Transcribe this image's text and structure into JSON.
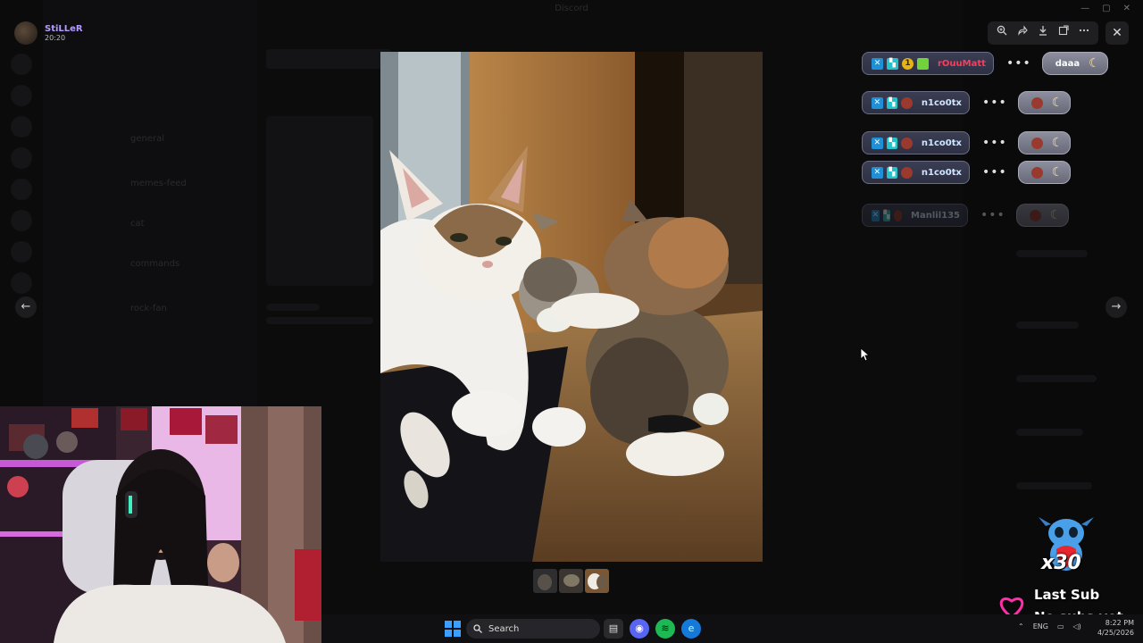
{
  "window": {
    "title": "Discord",
    "controls": [
      "—",
      "▢",
      "✕"
    ]
  },
  "user": {
    "name": "StiLLeR",
    "time": "20:20"
  },
  "background": {
    "channels": [
      "general",
      "memes-feed",
      "cat",
      "commands",
      "rock-fan"
    ]
  },
  "viewer": {
    "toolbar_icons": [
      "zoom-icon",
      "forward-icon",
      "download-icon",
      "open-external-icon",
      "more-icon"
    ],
    "close_glyph": "✕",
    "prev_glyph": "←",
    "next_glyph": "→",
    "thumbnails": 3,
    "selected_thumbnail": 3
  },
  "chat_overlay": {
    "messages": [
      {
        "user": "rOuuMatt",
        "badges": [
          "blue",
          "teal",
          "gold",
          "green"
        ],
        "badge_number": "1",
        "text": "daaa",
        "name_color": "#ff3b5c"
      },
      {
        "user": "n1co0tx",
        "badges": [
          "blue",
          "teal",
          "pot"
        ],
        "text": "",
        "name_color": "#cfe6ff"
      },
      {
        "user": "n1co0tx",
        "badges": [
          "blue",
          "teal",
          "pot"
        ],
        "text": "",
        "name_color": "#cfe6ff"
      },
      {
        "user": "n1co0tx",
        "badges": [
          "blue",
          "teal",
          "pot"
        ],
        "text": "",
        "name_color": "#cfe6ff"
      },
      {
        "user": "Manlil135",
        "badges": [
          "blue",
          "teal",
          "pot"
        ],
        "text": "",
        "name_color": "#cfe6ff"
      }
    ]
  },
  "subs_widget": {
    "count": "x30",
    "last_sub_label": "Last Sub",
    "last_sub_value": "No subs yet"
  },
  "taskbar": {
    "search_label": "Search",
    "language": "ENG",
    "time": "8:22 PM",
    "date": "4/25/2026"
  },
  "colors": {
    "accent": "#b39cff",
    "heart": "#ff2fa8",
    "start": "#3aa0ff"
  }
}
